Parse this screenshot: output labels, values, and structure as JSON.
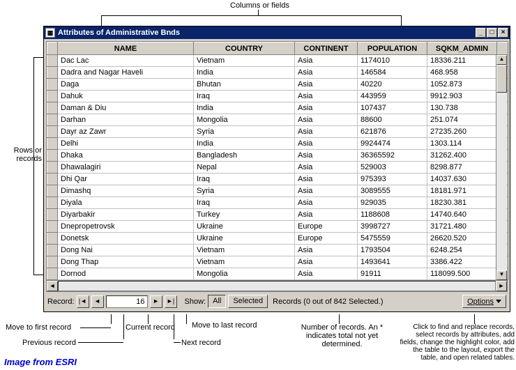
{
  "window": {
    "title": "Attributes of Administrative Bnds"
  },
  "annotations": {
    "columns": "Columns or fields",
    "rows": "Rows or records",
    "first": "Move to first record",
    "prev": "Previous record",
    "current": "Current record",
    "next": "Next record",
    "last": "Move to last record",
    "numrec": "Number of records. An * indicates total not yet determined.",
    "options": "Click to find and replace records, select records by attributes, add fields, change the highlight color, add the table to the layout, export the table, and open related tables.",
    "credit": "Image from ESRI"
  },
  "columns": [
    "NAME",
    "COUNTRY",
    "CONTINENT",
    "POPULATION",
    "SQKM_ADMIN"
  ],
  "rows": [
    {
      "name": "Dac Lac",
      "country": "Vietnam",
      "continent": "Asia",
      "pop": "1174010",
      "sqkm": "18336.211"
    },
    {
      "name": "Dadra and Nagar Haveli",
      "country": "India",
      "continent": "Asia",
      "pop": "146584",
      "sqkm": "468.958"
    },
    {
      "name": "Daga",
      "country": "Bhutan",
      "continent": "Asia",
      "pop": "40220",
      "sqkm": "1052.873"
    },
    {
      "name": "Dahuk",
      "country": "Iraq",
      "continent": "Asia",
      "pop": "443959",
      "sqkm": "9912.903"
    },
    {
      "name": "Daman & Diu",
      "country": "India",
      "continent": "Asia",
      "pop": "107437",
      "sqkm": "130.738"
    },
    {
      "name": "Darhan",
      "country": "Mongolia",
      "continent": "Asia",
      "pop": "88600",
      "sqkm": "251.074"
    },
    {
      "name": "Dayr az Zawr",
      "country": "Syria",
      "continent": "Asia",
      "pop": "621876",
      "sqkm": "27235.260"
    },
    {
      "name": "Delhi",
      "country": "India",
      "continent": "Asia",
      "pop": "9924474",
      "sqkm": "1303.114"
    },
    {
      "name": "Dhaka",
      "country": "Bangladesh",
      "continent": "Asia",
      "pop": "36365592",
      "sqkm": "31262.400"
    },
    {
      "name": "Dhawalagiri",
      "country": "Nepal",
      "continent": "Asia",
      "pop": "529003",
      "sqkm": "8298.877"
    },
    {
      "name": "Dhi Qar",
      "country": "Iraq",
      "continent": "Asia",
      "pop": "975393",
      "sqkm": "14037.630"
    },
    {
      "name": "Dimashq",
      "country": "Syria",
      "continent": "Asia",
      "pop": "3089555",
      "sqkm": "18181.971"
    },
    {
      "name": "Diyala",
      "country": "Iraq",
      "continent": "Asia",
      "pop": "929035",
      "sqkm": "18230.381"
    },
    {
      "name": "Diyarbakir",
      "country": "Turkey",
      "continent": "Asia",
      "pop": "1188608",
      "sqkm": "14740.640"
    },
    {
      "name": "Dnepropetrovsk",
      "country": "Ukraine",
      "continent": "Europe",
      "pop": "3998727",
      "sqkm": "31721.480"
    },
    {
      "name": "Donetsk",
      "country": "Ukraine",
      "continent": "Europe",
      "pop": "5475559",
      "sqkm": "26620.520"
    },
    {
      "name": "Dong Nai",
      "country": "Vietnam",
      "continent": "Asia",
      "pop": "1793504",
      "sqkm": "6248.254"
    },
    {
      "name": "Dong Thap",
      "country": "Vietnam",
      "continent": "Asia",
      "pop": "1493641",
      "sqkm": "3386.422"
    },
    {
      "name": "Dornod",
      "country": "Mongolia",
      "continent": "Asia",
      "pop": "91911",
      "sqkm": "118099.500"
    }
  ],
  "toolbar": {
    "record_label": "Record:",
    "current_record": "16",
    "show_label": "Show:",
    "all_label": "All",
    "selected_label": "Selected",
    "status": "Records (0 out of 842 Selected.)",
    "options_label": "Options"
  }
}
